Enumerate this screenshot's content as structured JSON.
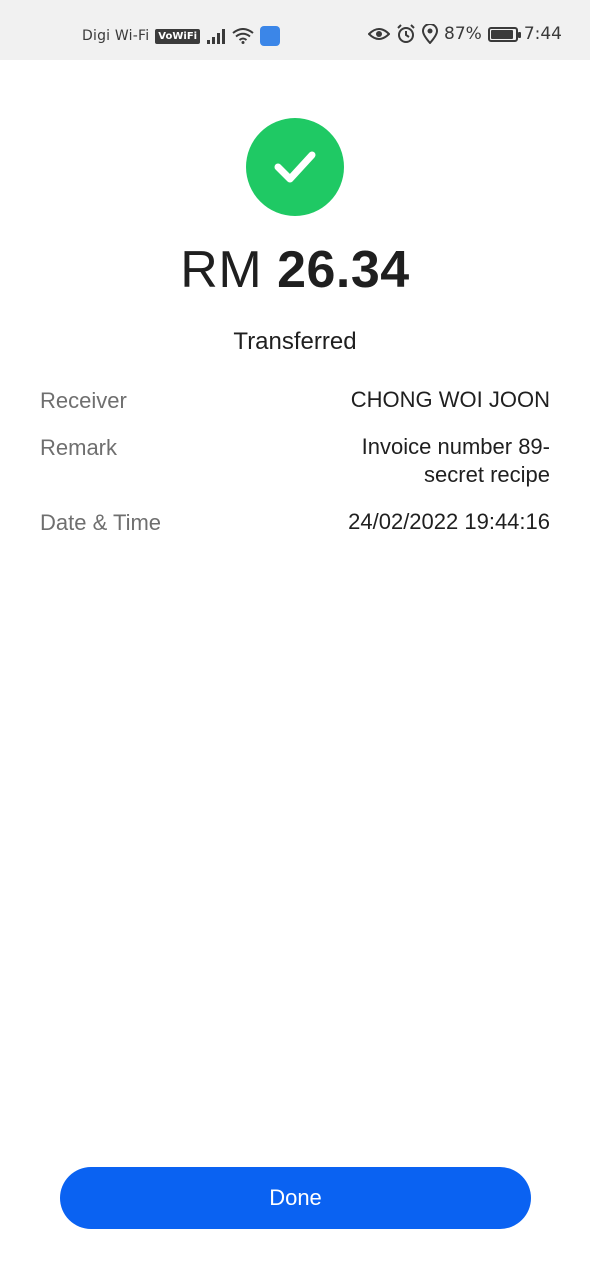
{
  "status_bar": {
    "carrier": "Digi Wi-Fi",
    "vowifi": "VoWiFi",
    "battery_percent": "87%",
    "time": "7:44"
  },
  "receipt": {
    "currency": "RM",
    "amount": "26.34",
    "status": "Transferred",
    "details": [
      {
        "label": "Receiver",
        "value": "CHONG WOI JOON"
      },
      {
        "label": "Remark",
        "value": "Invoice number 89- secret recipe"
      },
      {
        "label": "Date & Time",
        "value": "24/02/2022 19:44:16"
      }
    ]
  },
  "actions": {
    "done_label": "Done"
  },
  "colors": {
    "success": "#1fc964",
    "primary_button": "#0a62f2"
  },
  "icons": [
    "signal-icon",
    "wifi-icon",
    "app-notification-icon",
    "eye-icon",
    "alarm-icon",
    "location-icon",
    "battery-icon",
    "check-icon"
  ]
}
